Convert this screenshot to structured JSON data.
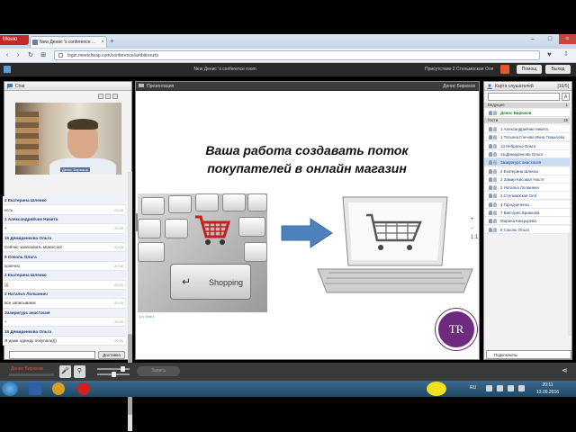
{
  "browser": {
    "menu_label": "Меню",
    "tab_title": "New Денис 's conference ...",
    "url": "login.meetcheap.com/conference/ambitrenzto"
  },
  "app": {
    "title": "New Денис 's conference room",
    "user": "Присутствие 2 Стельмоская Оля",
    "btn_help": "Помощ",
    "btn_exit": "Выход"
  },
  "chat": {
    "header": "Chat",
    "video_label": "Денис Бирюков",
    "send_label": "Доставка",
    "messages": [
      {
        "text": "2 Екатерина Шлеико",
        "time": "",
        "author": true
      },
      {
        "text": "есть",
        "time": "20:08",
        "author": false
      },
      {
        "text": "1 Александрийчик Никита",
        "time": "",
        "author": true
      },
      {
        "text": "+",
        "time": "20:08",
        "author": false
      },
      {
        "text": "15 Демиденкова Ольга",
        "time": "",
        "author": true
      },
      {
        "text": "Сейчас записывать можно ког",
        "time": "20:08",
        "author": false
      },
      {
        "text": "9 Соколь Ольга",
        "time": "",
        "author": true
      },
      {
        "text": "конечно",
        "time": "20:08",
        "author": false
      },
      {
        "text": "2 Екатерина Шлеико",
        "time": "",
        "author": true
      },
      {
        "text": ")))",
        "time": "20:09",
        "author": false
      },
      {
        "text": "2 Наталья Лопшинич",
        "time": "",
        "author": true
      },
      {
        "text": "все записываем",
        "time": "20:09",
        "author": false
      },
      {
        "text": "Зазиригурс анастасия",
        "time": "",
        "author": true
      },
      {
        "text": "+",
        "time": "20:09",
        "author": false
      },
      {
        "text": "15 Демиденкова Ольга",
        "time": "",
        "author": true
      },
      {
        "text": "Я даже одежду покупала)))",
        "time": "20:09",
        "author": false
      }
    ]
  },
  "presentation": {
    "header": "Презентация",
    "author": "Денис Бирюков",
    "slide_title_line1": "Ваша работа  создавать поток",
    "slide_title_line2": "покупателей в онлайн магазин",
    "shopping_key": "Shopping",
    "copyright": "(c) Jinie1",
    "logo_text": "TR",
    "zoom_in": "+",
    "zoom_out": "−",
    "zoom_fit": "1:1"
  },
  "participants": {
    "header": "Карта слушателей",
    "count": "[16/5]",
    "filter": "Все",
    "group_speakers": "Ведущие",
    "group_speakers_count": "1",
    "group_listeners": "Гости",
    "group_listeners_count": "15",
    "host": "Денис Бирюков",
    "list": [
      "1 Александрийчик Никита",
      "1 Татьяна Гончевя Инна Пожилова",
      "14 Небраско Ольга",
      "15 Демиденкова Ольга",
      "Зазиригурс анастасия",
      "2 Екатерина Шлеико",
      "2 Замир-Кисовал Настя",
      "2 Наталья Лопшинич",
      "2 Стельмоская Оля",
      "4 Городниченко",
      "7 Виктория Бриакова",
      "Марина Канцырева",
      "9 Соколь Ольга"
    ],
    "bottom_label": "Подключены"
  },
  "toolbar": {
    "presenter": "Денис Бирюков",
    "record_label": "Запись"
  },
  "taskbar": {
    "lang": "RU",
    "time": "20:11",
    "date": "13.09.2016"
  }
}
